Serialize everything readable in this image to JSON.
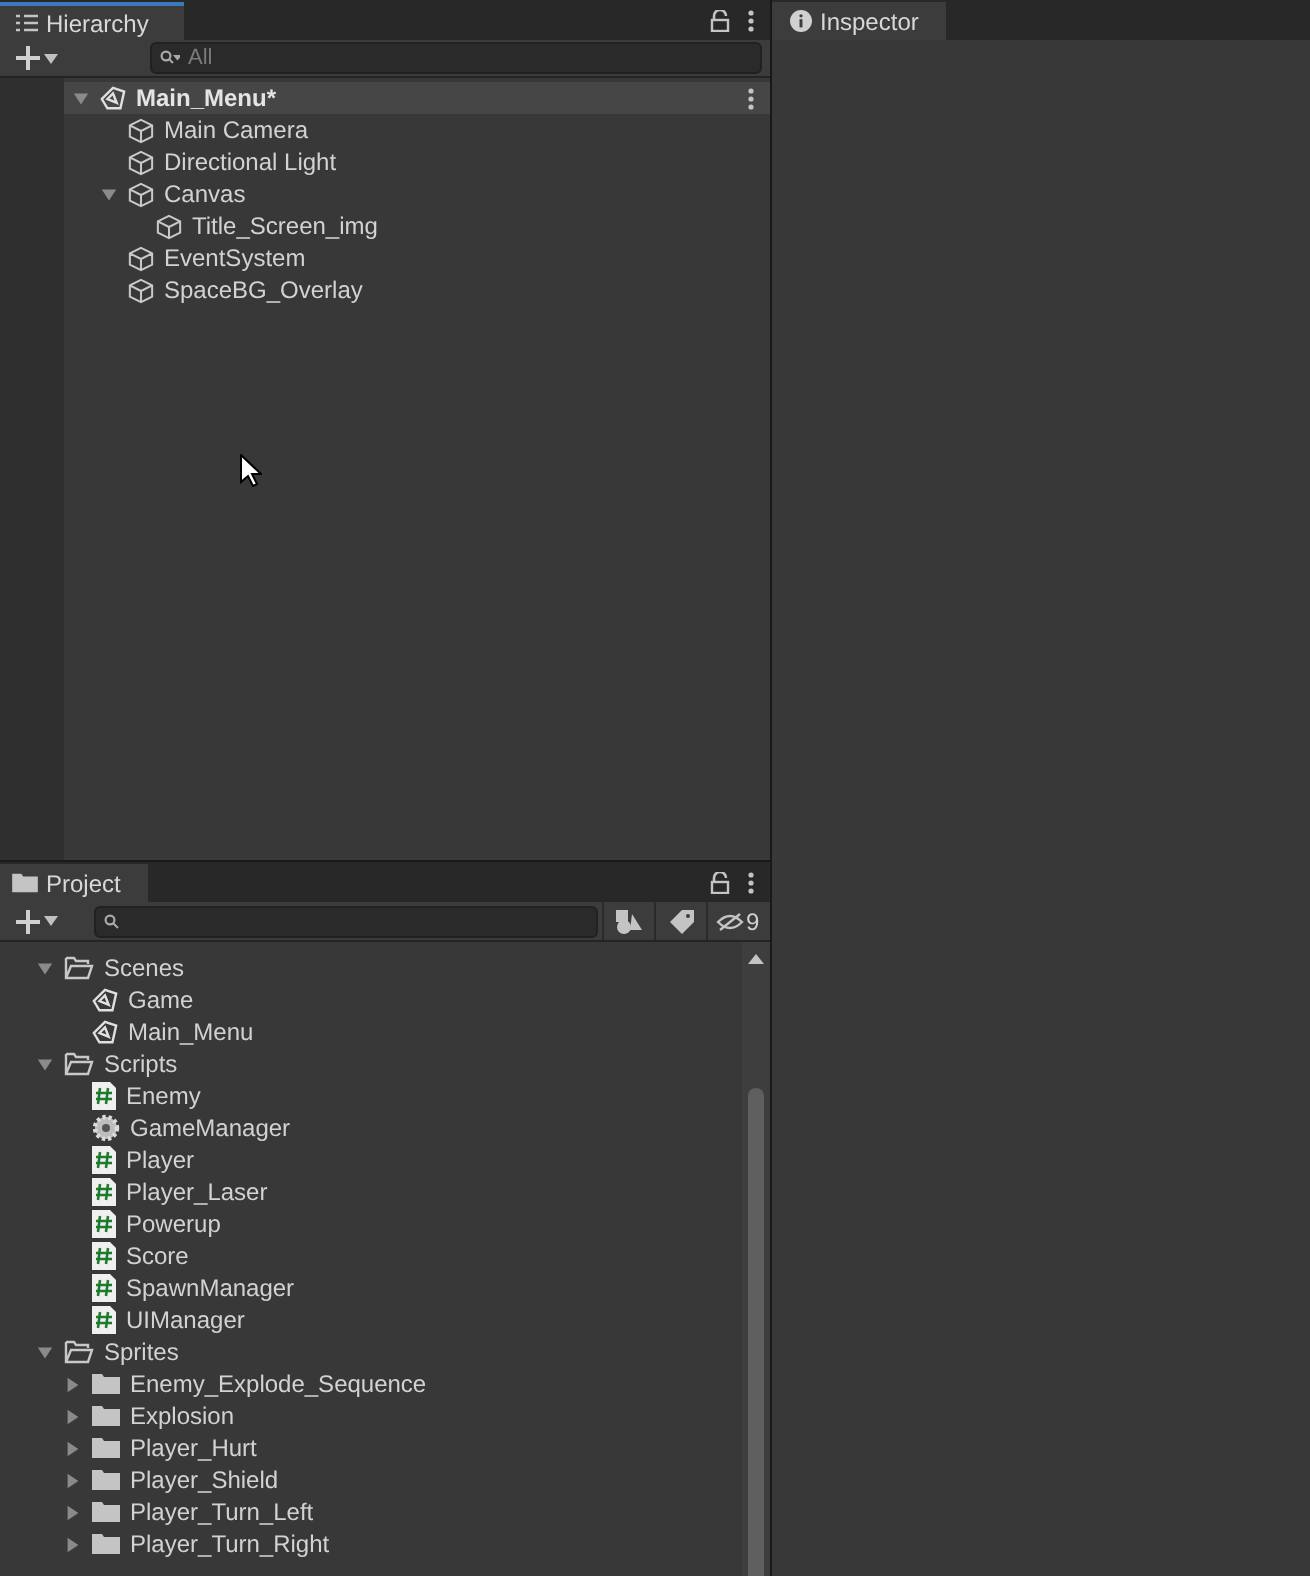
{
  "hierarchy": {
    "tab": "Hierarchy",
    "search": {
      "placeholder": "All"
    },
    "items": [
      {
        "kind": "scene",
        "label": "Main_Menu*",
        "expanded": true,
        "children": [
          {
            "kind": "object",
            "label": "Main Camera"
          },
          {
            "kind": "object",
            "label": "Directional Light"
          },
          {
            "kind": "object",
            "label": "Canvas",
            "expanded": true,
            "children": [
              {
                "kind": "object",
                "label": "Title_Screen_img"
              }
            ]
          },
          {
            "kind": "object",
            "label": "EventSystem"
          },
          {
            "kind": "object",
            "label": "SpaceBG_Overlay"
          }
        ]
      }
    ]
  },
  "inspector": {
    "tab": "Inspector"
  },
  "project": {
    "tab": "Project",
    "hidden_count": "9",
    "items": [
      {
        "kind": "folder",
        "label": "Scenes",
        "expanded": true,
        "children": [
          {
            "kind": "scene",
            "label": "Game"
          },
          {
            "kind": "scene",
            "label": "Main_Menu"
          }
        ]
      },
      {
        "kind": "folder",
        "label": "Scripts",
        "expanded": true,
        "children": [
          {
            "kind": "script",
            "label": "Enemy"
          },
          {
            "kind": "gear",
            "label": "GameManager"
          },
          {
            "kind": "script",
            "label": "Player"
          },
          {
            "kind": "script",
            "label": "Player_Laser"
          },
          {
            "kind": "script",
            "label": "Powerup"
          },
          {
            "kind": "script",
            "label": "Score"
          },
          {
            "kind": "script",
            "label": "SpawnManager"
          },
          {
            "kind": "script",
            "label": "UIManager"
          }
        ]
      },
      {
        "kind": "folder",
        "label": "Sprites",
        "expanded": true,
        "children": [
          {
            "kind": "folder",
            "label": "Enemy_Explode_Sequence",
            "expanded": false
          },
          {
            "kind": "folder",
            "label": "Explosion",
            "expanded": false
          },
          {
            "kind": "folder",
            "label": "Player_Hurt",
            "expanded": false
          },
          {
            "kind": "folder",
            "label": "Player_Shield",
            "expanded": false
          },
          {
            "kind": "folder",
            "label": "Player_Turn_Left",
            "expanded": false
          },
          {
            "kind": "folder",
            "label": "Player_Turn_Right",
            "expanded": false
          }
        ]
      }
    ]
  }
}
